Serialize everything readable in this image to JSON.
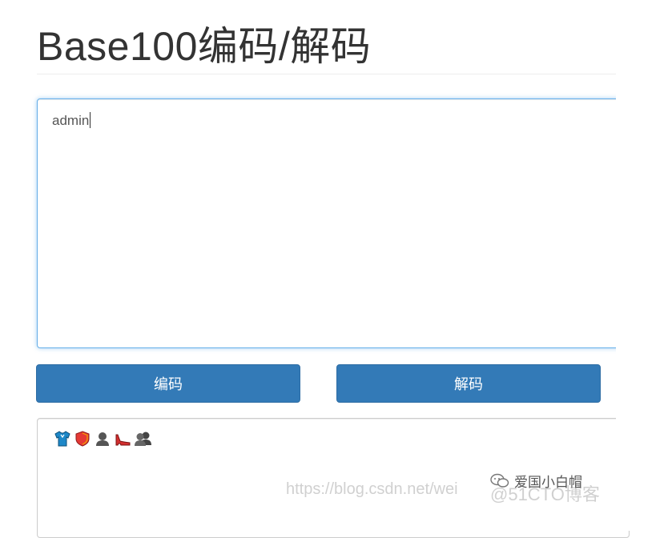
{
  "header": {
    "title": "Base100编码/解码"
  },
  "input": {
    "value": "admin"
  },
  "buttons": {
    "encode_label": "编码",
    "decode_label": "解码"
  },
  "output": {
    "emoji_icons": [
      "tshirt-icon",
      "shield-icon",
      "bust-silhouette-icon",
      "high-heel-icon",
      "busts-silhouette-icon"
    ]
  },
  "watermark": {
    "url": "https://blog.csdn.net/wei",
    "handle": "@51CTO博客",
    "brand": "爱国小白帽"
  },
  "colors": {
    "accent": "#337ab7",
    "focus_border": "#66afe9",
    "title_text": "#333333"
  }
}
